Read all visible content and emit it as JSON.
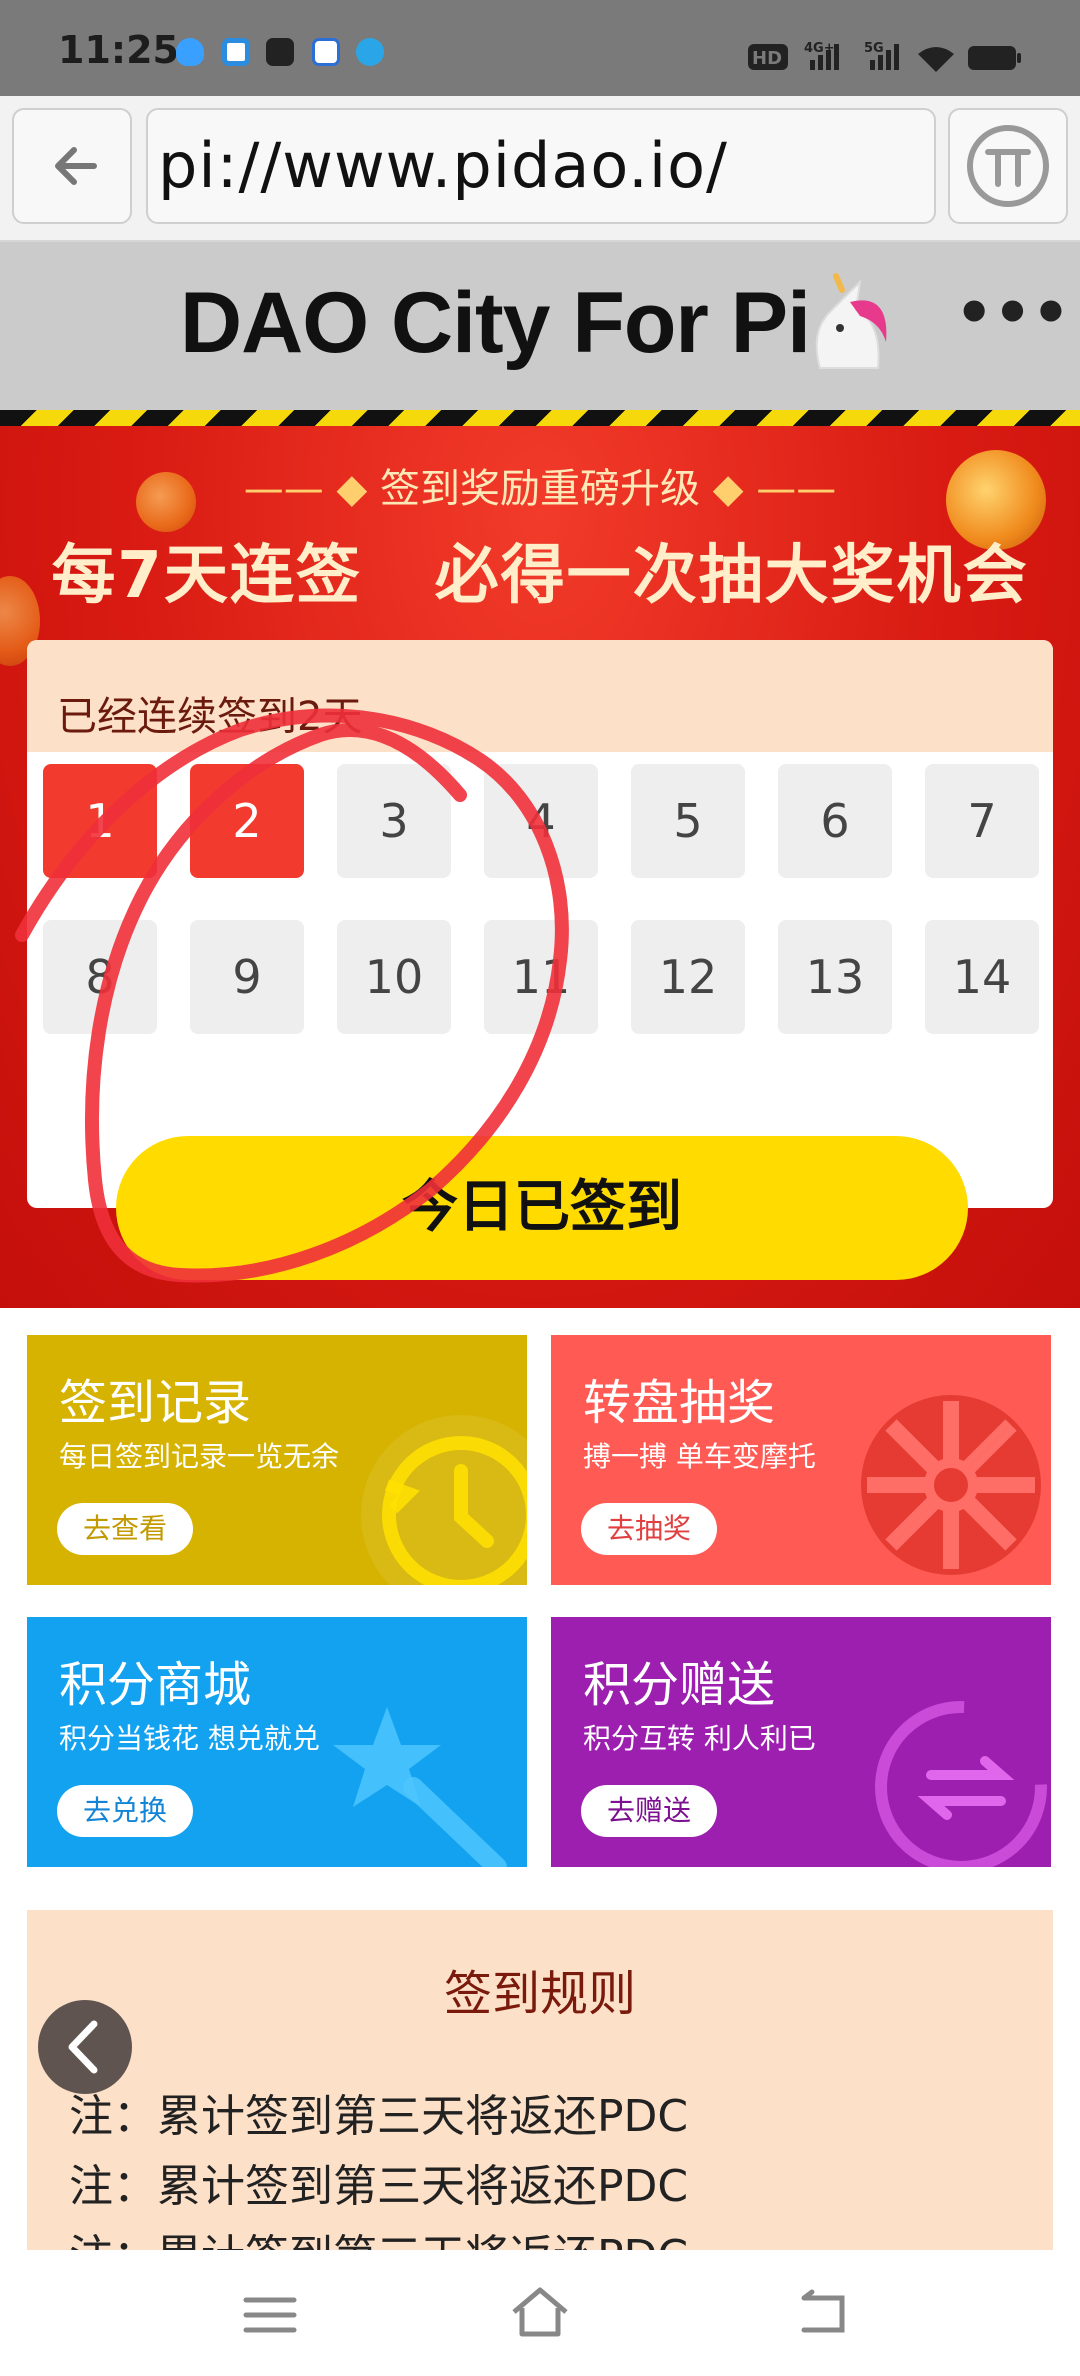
{
  "status_bar": {
    "time": "11:25"
  },
  "browser": {
    "url": "pi://www.pidao.io/"
  },
  "site": {
    "title": "DAO City For Pi"
  },
  "banner": {
    "subtitle": "签到奖励重磅升级",
    "headline": "每7天连签   必得一次抽大奖机会",
    "streak_text": "已经连续签到2天",
    "days": [
      {
        "label": "1",
        "signed": true
      },
      {
        "label": "2",
        "signed": true
      },
      {
        "label": "3",
        "signed": false
      },
      {
        "label": "4",
        "signed": false
      },
      {
        "label": "5",
        "signed": false
      },
      {
        "label": "6",
        "signed": false
      },
      {
        "label": "7",
        "signed": false
      },
      {
        "label": "8",
        "signed": false
      },
      {
        "label": "9",
        "signed": false
      },
      {
        "label": "10",
        "signed": false
      },
      {
        "label": "11",
        "signed": false
      },
      {
        "label": "12",
        "signed": false
      },
      {
        "label": "13",
        "signed": false
      },
      {
        "label": "14",
        "signed": false
      }
    ],
    "signed_button": "今日已签到"
  },
  "cards": [
    {
      "title": "签到记录",
      "subtitle": "每日签到记录一览无余",
      "button": "去查看",
      "color": "#d6b300",
      "button_color": "#c29a00"
    },
    {
      "title": "转盘抽奖",
      "subtitle": "搏一搏 单车变摩托",
      "button": "去抽奖",
      "color": "#ff5b54",
      "button_color": "#e04040"
    },
    {
      "title": "积分商城",
      "subtitle": "积分当钱花 想兑就兑",
      "button": "去兑换",
      "color": "#13a2f0",
      "button_color": "#1485d6"
    },
    {
      "title": "积分赠送",
      "subtitle": "积分互转 利人利已",
      "button": "去赠送",
      "color": "#9d1fb0",
      "button_color": "#7c1090"
    }
  ],
  "rules": {
    "title": "签到规则",
    "lines": [
      "注：累计签到第三天将返还PDC",
      "注：累计签到第三天将返还PDC",
      "注：累计签到第三天将返还PDC"
    ]
  },
  "colors": {
    "primary_red": "#d81a12",
    "yellow": "#ffdb00",
    "rules_bg": "#fde0c8",
    "annotation": "#f0303a"
  }
}
